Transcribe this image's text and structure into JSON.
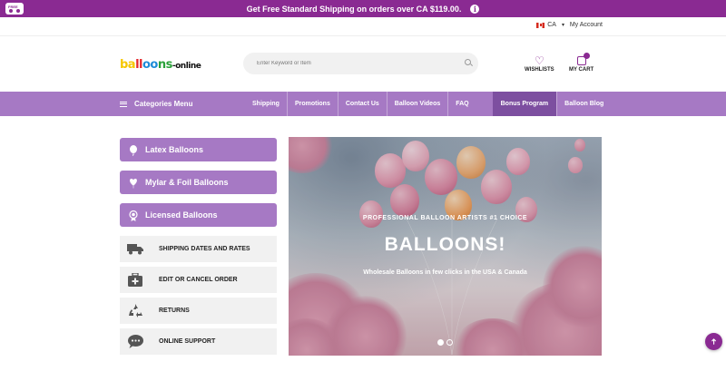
{
  "promo": {
    "text": "Get Free Standard Shipping on orders over CA $119.00.",
    "badge": "FREE",
    "info_icon": "info-icon"
  },
  "utility": {
    "country": "CA",
    "account": "My Account"
  },
  "header": {
    "logo": {
      "part1": "ba",
      "part2": "ll",
      "part3": "oo",
      "part4": "ns",
      "suffix": "-online"
    },
    "search_placeholder": "Enter Keyword or Item",
    "wishlist_label": "WISHLISTS",
    "cart_label": "MY CART"
  },
  "nav": {
    "categories": "Categories Menu",
    "links": [
      "Shipping",
      "Promotions",
      "Contact Us",
      "Balloon Videos",
      "FAQ",
      "Bonus Program",
      "Balloon Blog"
    ]
  },
  "sidebar": {
    "categories": [
      "Latex Balloons",
      "Mylar & Foil Balloons",
      "Licensed Balloons"
    ],
    "services": [
      {
        "label": "SHIPPING DATES AND RATES",
        "icon": "truck-icon"
      },
      {
        "label": "EDIT OR CANCEL ORDER",
        "icon": "first-aid-kit-icon"
      },
      {
        "label": "RETURNS",
        "icon": "recycle-icon"
      },
      {
        "label": "ONLINE SUPPORT",
        "icon": "chat-bubble-icon"
      }
    ]
  },
  "hero": {
    "kicker": "PROFESSIONAL BALLOON ARTISTS #1 CHOICE",
    "title": "BALLOONS!",
    "subtitle": "Wholesale Balloons in few clicks in the USA & Canada",
    "slides": 2,
    "active_slide": 1
  },
  "colors": {
    "brand": "#8a2a92",
    "nav": "#a679c4",
    "bonus": "#7d4fa0"
  }
}
